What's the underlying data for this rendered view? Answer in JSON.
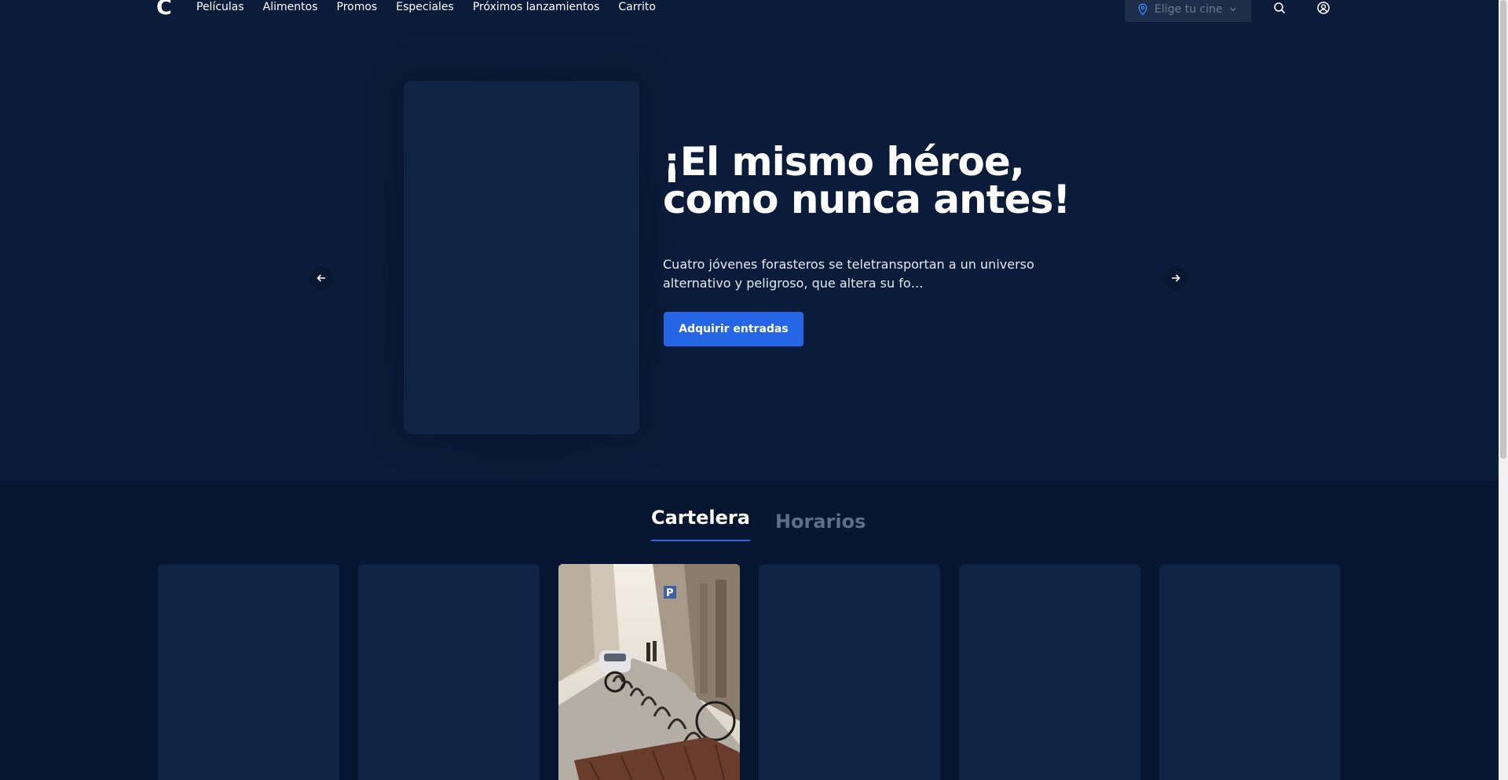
{
  "header": {
    "logo": "C",
    "nav": [
      "Películas",
      "Alimentos",
      "Promos",
      "Especiales",
      "Próximos lanzamientos",
      "Carrito"
    ],
    "cinema_select_label": "Elige tu cine",
    "icons": [
      "location-pin-icon",
      "chevron-down-icon",
      "search-icon",
      "user-icon"
    ]
  },
  "hero": {
    "title": "¡El mismo héroe, como nunca antes!",
    "description": "Cuatro jóvenes forasteros se teletransportan a un universo alternativo y peligroso, que altera su fo…",
    "cta_label": "Adquirir entradas"
  },
  "tabs": [
    {
      "label": "Cartelera",
      "active": true
    },
    {
      "label": "Horarios",
      "active": false
    }
  ],
  "colors": {
    "background": "#061631",
    "hero_background": "#0b1c3a",
    "accent": "#2466e6",
    "card_placeholder": "#0f2343"
  }
}
